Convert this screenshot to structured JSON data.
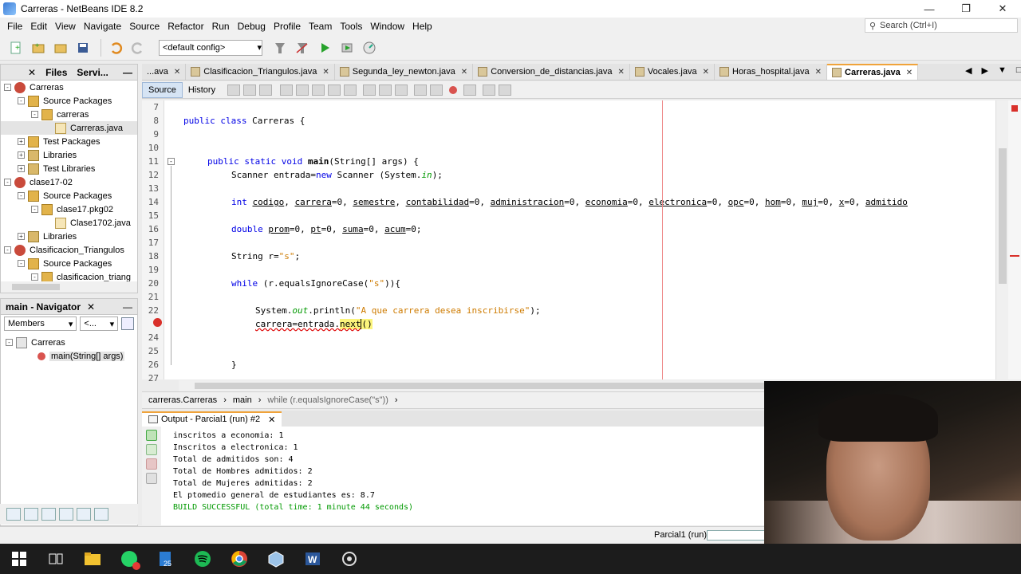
{
  "window": {
    "title": "Carreras - NetBeans IDE 8.2"
  },
  "menu": [
    "File",
    "Edit",
    "View",
    "Navigate",
    "Source",
    "Refactor",
    "Run",
    "Debug",
    "Profile",
    "Team",
    "Tools",
    "Window",
    "Help"
  ],
  "search": {
    "placeholder": "Search (Ctrl+I)"
  },
  "toolbar": {
    "config": "<default config>"
  },
  "projects_panel": {
    "tabs": [
      "Files",
      "Servi..."
    ],
    "tree": [
      {
        "label": "Carreras",
        "icon": "project-icon",
        "depth": 0,
        "toggle": "-"
      },
      {
        "label": "Source Packages",
        "icon": "source-packages-icon",
        "depth": 1,
        "toggle": "-"
      },
      {
        "label": "carreras",
        "icon": "package-icon",
        "depth": 2,
        "toggle": "-"
      },
      {
        "label": "Carreras.java",
        "icon": "java-file-icon",
        "depth": 3,
        "toggle": ""
      },
      {
        "label": "Test Packages",
        "icon": "test-packages-icon",
        "depth": 1,
        "toggle": "+"
      },
      {
        "label": "Libraries",
        "icon": "libraries-icon",
        "depth": 1,
        "toggle": "+"
      },
      {
        "label": "Test Libraries",
        "icon": "test-libraries-icon",
        "depth": 1,
        "toggle": "+"
      },
      {
        "label": "clase17-02",
        "icon": "project-icon",
        "depth": 0,
        "toggle": "-"
      },
      {
        "label": "Source Packages",
        "icon": "source-packages-icon",
        "depth": 1,
        "toggle": "-"
      },
      {
        "label": "clase17.pkg02",
        "icon": "package-icon",
        "depth": 2,
        "toggle": "-"
      },
      {
        "label": "Clase1702.java",
        "icon": "java-file-icon",
        "depth": 3,
        "toggle": ""
      },
      {
        "label": "Libraries",
        "icon": "libraries-icon",
        "depth": 1,
        "toggle": "+"
      },
      {
        "label": "Clasificacion_Triangulos",
        "icon": "project-icon",
        "depth": 0,
        "toggle": "-"
      },
      {
        "label": "Source Packages",
        "icon": "source-packages-icon",
        "depth": 1,
        "toggle": "-"
      },
      {
        "label": "clasificacion_triang",
        "icon": "package-icon",
        "depth": 2,
        "toggle": "-"
      }
    ]
  },
  "navigator": {
    "title": "main - Navigator",
    "filter": "Members",
    "filter2": "<...",
    "tree": [
      {
        "label": "Carreras",
        "depth": 0
      },
      {
        "label": "main(String[] args)",
        "depth": 1
      }
    ]
  },
  "editor_tabs": [
    {
      "label": "...ava",
      "active": false
    },
    {
      "label": "Clasificacion_Triangulos.java",
      "active": false
    },
    {
      "label": "Segunda_ley_newton.java",
      "active": false
    },
    {
      "label": "Conversion_de_distancias.java",
      "active": false
    },
    {
      "label": "Vocales.java",
      "active": false
    },
    {
      "label": "Horas_hospital.java",
      "active": false
    },
    {
      "label": "Carreras.java",
      "active": true
    }
  ],
  "editor": {
    "source_tab": "Source",
    "history_tab": "History",
    "line_numbers": [
      "7",
      "8",
      "9",
      "10",
      "11",
      "12",
      "13",
      "14",
      "15",
      "16",
      "17",
      "18",
      "19",
      "20",
      "21",
      "22",
      "",
      "24",
      "25",
      "26",
      "27"
    ]
  },
  "breadcrumb": [
    "carreras.Carreras",
    "main",
    "while (r.equalsIgnoreCase(\"s\"))"
  ],
  "output": {
    "tab": "Output - Parcial1 (run) #2",
    "lines": [
      "inscritos a economia: 1",
      "Inscritos a electronica: 1",
      "Total de admitidos son: 4",
      "Total de Hombres admitidos: 2",
      "Total de Mujeres admitidas: 2",
      "El ptomedio general de estudiantes es: 8.7"
    ],
    "success": "BUILD SUCCESSFUL (total time: 1 minute 44 seconds)"
  },
  "status": {
    "project": "Parcial1 (run)"
  },
  "colors": {
    "accent": "#f0a33a",
    "keyword": "#0000e6",
    "string": "#ce7b00",
    "success": "#009900"
  }
}
